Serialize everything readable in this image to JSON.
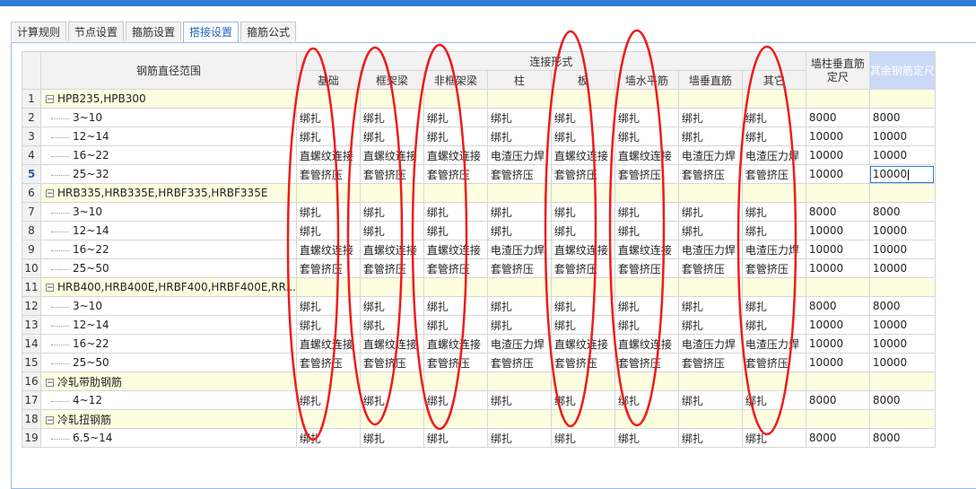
{
  "tabs": [
    "计算规则",
    "节点设置",
    "箍筋设置",
    "搭接设置",
    "箍筋公式"
  ],
  "active_tab": 3,
  "header": {
    "range": "钢筋直径范围",
    "group": "连接形式",
    "cols": [
      "基础",
      "框架梁",
      "非框架梁",
      "柱",
      "板",
      "墙水平筋",
      "墙垂直筋",
      "其它"
    ],
    "wall_len_l1": "墙柱垂直筋",
    "wall_len_l2": "定尺",
    "other_len": "其余钢筋定尺"
  },
  "rows": [
    {
      "n": "1",
      "group": true,
      "name": "HPB235,HPB300"
    },
    {
      "n": "2",
      "name": "3~10",
      "v": [
        "绑扎",
        "绑扎",
        "绑扎",
        "绑扎",
        "绑扎",
        "绑扎",
        "绑扎",
        "绑扎"
      ],
      "a": "8000",
      "b": "8000"
    },
    {
      "n": "3",
      "name": "12~14",
      "v": [
        "绑扎",
        "绑扎",
        "绑扎",
        "绑扎",
        "绑扎",
        "绑扎",
        "绑扎",
        "绑扎"
      ],
      "a": "10000",
      "b": "10000"
    },
    {
      "n": "4",
      "name": "16~22",
      "v": [
        "直螺纹连接",
        "直螺纹连接",
        "直螺纹连接",
        "电渣压力焊",
        "直螺纹连接",
        "直螺纹连接",
        "电渣压力焊",
        "电渣压力焊"
      ],
      "a": "10000",
      "b": "10000"
    },
    {
      "n": "5",
      "name": "25~32",
      "v": [
        "套管挤压",
        "套管挤压",
        "套管挤压",
        "套管挤压",
        "套管挤压",
        "套管挤压",
        "套管挤压",
        "套管挤压"
      ],
      "a": "10000",
      "b": "10000",
      "current": true
    },
    {
      "n": "6",
      "group": true,
      "name": "HRB335,HRB335E,HRBF335,HRBF335E"
    },
    {
      "n": "7",
      "name": "3~10",
      "v": [
        "绑扎",
        "绑扎",
        "绑扎",
        "绑扎",
        "绑扎",
        "绑扎",
        "绑扎",
        "绑扎"
      ],
      "a": "8000",
      "b": "8000"
    },
    {
      "n": "8",
      "name": "12~14",
      "v": [
        "绑扎",
        "绑扎",
        "绑扎",
        "绑扎",
        "绑扎",
        "绑扎",
        "绑扎",
        "绑扎"
      ],
      "a": "10000",
      "b": "10000"
    },
    {
      "n": "9",
      "name": "16~22",
      "v": [
        "直螺纹连接",
        "直螺纹连接",
        "直螺纹连接",
        "电渣压力焊",
        "直螺纹连接",
        "直螺纹连接",
        "电渣压力焊",
        "电渣压力焊"
      ],
      "a": "10000",
      "b": "10000"
    },
    {
      "n": "10",
      "name": "25~50",
      "v": [
        "套管挤压",
        "套管挤压",
        "套管挤压",
        "套管挤压",
        "套管挤压",
        "套管挤压",
        "套管挤压",
        "套管挤压"
      ],
      "a": "10000",
      "b": "10000"
    },
    {
      "n": "11",
      "group": true,
      "name": "HRB400,HRB400E,HRBF400,HRBF400E,RR..."
    },
    {
      "n": "12",
      "name": "3~10",
      "v": [
        "绑扎",
        "绑扎",
        "绑扎",
        "绑扎",
        "绑扎",
        "绑扎",
        "绑扎",
        "绑扎"
      ],
      "a": "8000",
      "b": "8000"
    },
    {
      "n": "13",
      "name": "12~14",
      "v": [
        "绑扎",
        "绑扎",
        "绑扎",
        "绑扎",
        "绑扎",
        "绑扎",
        "绑扎",
        "绑扎"
      ],
      "a": "10000",
      "b": "10000"
    },
    {
      "n": "14",
      "name": "16~22",
      "v": [
        "直螺纹连接",
        "直螺纹连接",
        "直螺纹连接",
        "电渣压力焊",
        "直螺纹连接",
        "直螺纹连接",
        "电渣压力焊",
        "电渣压力焊"
      ],
      "a": "10000",
      "b": "10000"
    },
    {
      "n": "15",
      "name": "25~50",
      "v": [
        "套管挤压",
        "套管挤压",
        "套管挤压",
        "套管挤压",
        "套管挤压",
        "套管挤压",
        "套管挤压",
        "套管挤压"
      ],
      "a": "10000",
      "b": "10000"
    },
    {
      "n": "16",
      "group": true,
      "name": "冷轧带肋钢筋"
    },
    {
      "n": "17",
      "name": "4~12",
      "v": [
        "绑扎",
        "绑扎",
        "绑扎",
        "绑扎",
        "绑扎",
        "绑扎",
        "绑扎",
        "绑扎"
      ],
      "a": "8000",
      "b": "8000"
    },
    {
      "n": "18",
      "group": true,
      "name": "冷轧扭钢筋"
    },
    {
      "n": "19",
      "name": "6.5~14",
      "v": [
        "绑扎",
        "绑扎",
        "绑扎",
        "绑扎",
        "绑扎",
        "绑扎",
        "绑扎",
        "绑扎"
      ],
      "a": "8000",
      "b": "8000"
    }
  ],
  "colors": {
    "accent": "#2f7dd6",
    "group_row": "#fdfde0",
    "annotation": "#ee1c1c"
  }
}
